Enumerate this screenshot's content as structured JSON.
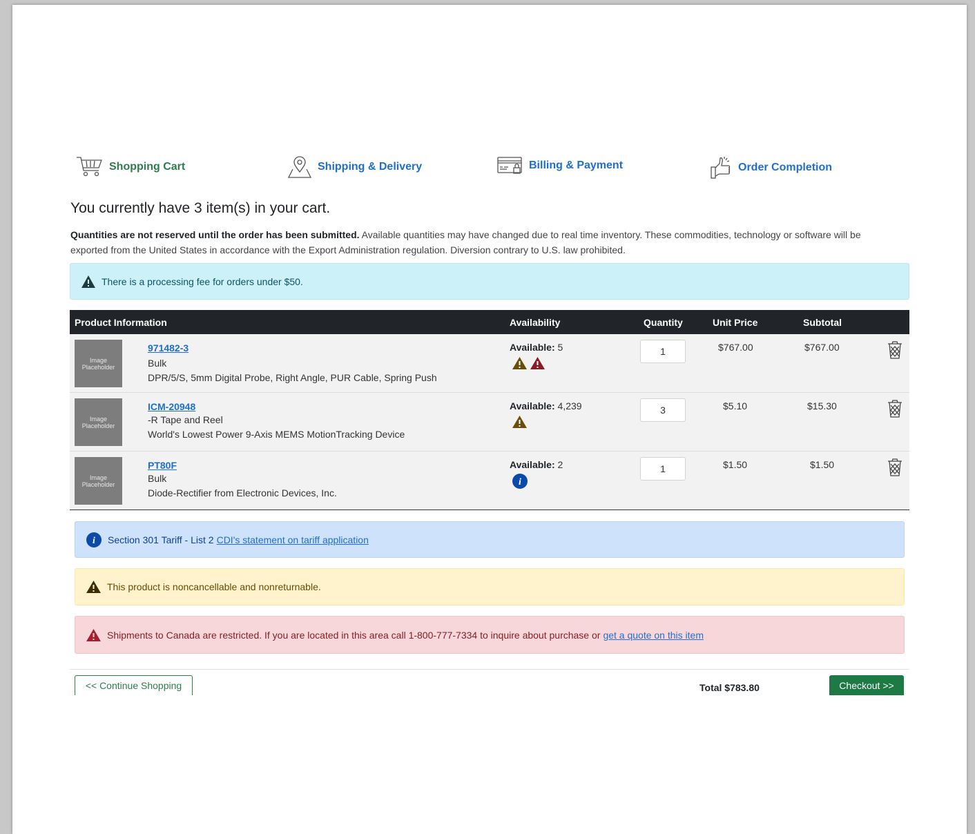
{
  "steps": [
    {
      "label": "Shopping Cart",
      "icon": "shopping-cart-icon",
      "active": true
    },
    {
      "label": "Shipping & Delivery",
      "icon": "map-pin-icon"
    },
    {
      "label": "Billing & Payment",
      "icon": "credit-card-icon"
    },
    {
      "label": "Order Completion",
      "icon": "thumbs-up-icon"
    }
  ],
  "cart": {
    "heading": "You currently have 3 item(s) in your cart.",
    "notice_bold": "Quantities are not reserved until the order has been submitted.",
    "notice_text": " Available quantities may have changed due to real time inventory. These commodities, technology or software will be exported from the United States in accordance with the Export Administration regulation. Diversion contrary to U.S. law prohibited.",
    "fee_alert": "There is a processing fee for orders under $50."
  },
  "table": {
    "headers": [
      "Product Information",
      "Availability",
      "Quantity",
      "Unit Price",
      "Subtotal"
    ],
    "image_placeholder": "Image Placeholder",
    "available_label": "Available:",
    "rows": [
      {
        "part": "971482-3",
        "package": "Bulk",
        "description": "DPR/5/S, 5mm Digital Probe, Right Angle, PUR Cable, Spring Push",
        "available": "5",
        "qty": "1",
        "unit_price": "$767.00",
        "subtotal": "$767.00",
        "icons": [
          "warning-icon",
          "danger-icon"
        ]
      },
      {
        "part": "ICM-20948",
        "package": "-R Tape and Reel",
        "description": "World's Lowest Power 9-Axis MEMS MotionTracking Device",
        "available": "4,239",
        "qty": "3",
        "unit_price": "$5.10",
        "subtotal": "$15.30",
        "icons": [
          "warning-icon"
        ]
      },
      {
        "part": "PT80F",
        "package": "Bulk",
        "description": "Diode-Rectifier from Electronic Devices, Inc.",
        "available": "2",
        "qty": "1",
        "unit_price": "$1.50",
        "subtotal": "$1.50",
        "icons": [
          "info-icon"
        ]
      }
    ]
  },
  "alerts": {
    "info_text": "Section 301 Tariff - List 2",
    "info_link": "CDI's statement on tariff application",
    "warn_text": "This product is noncancellable and nonreturnable.",
    "danger_text": "Shipments to Canada are restricted. If you are located in this area call 1-800-777-7334 to inquire about purchase or",
    "danger_link": "get a quote on this item"
  },
  "footer": {
    "continue_label": "<< Continue Shopping",
    "total_label": "Total $783.80",
    "checkout_label": "Checkout >>"
  },
  "colors": {
    "accent_green": "#2e7d4a",
    "link_blue": "#1e6fd0",
    "header_dark": "#212529"
  }
}
